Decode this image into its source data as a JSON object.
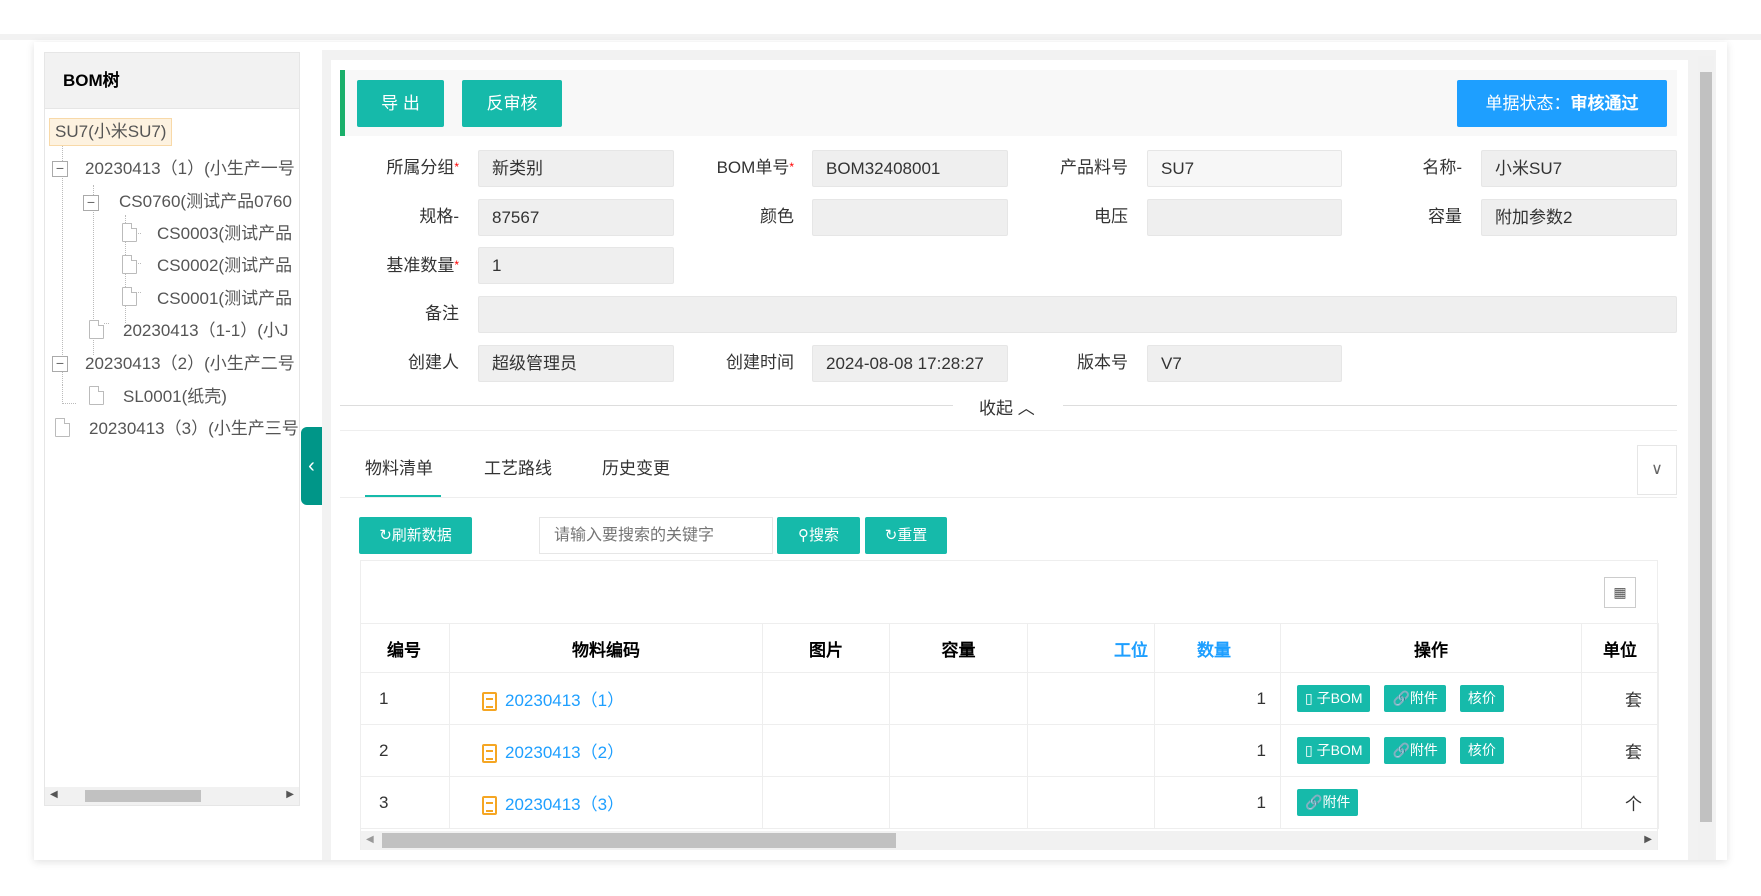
{
  "tree": {
    "title": "BOM树",
    "nodes": [
      {
        "label": "SU7(小米SU7)"
      },
      {
        "label": "20230413（1）(小生产一号"
      },
      {
        "label": "CS0760(测试产品0760"
      },
      {
        "label": "CS0003(测试产品"
      },
      {
        "label": "CS0002(测试产品"
      },
      {
        "label": "CS0001(测试产品"
      },
      {
        "label": "20230413（1-1）(小J"
      },
      {
        "label": "20230413（2）(小生产二号"
      },
      {
        "label": "SL0001(纸壳)"
      },
      {
        "label": "20230413（3）(小生产三号"
      }
    ]
  },
  "toolbar": {
    "export": "导 出",
    "unaudit": "反审核",
    "status_label": "单据状态：",
    "status_value": "审核通过"
  },
  "form": {
    "group": {
      "label": "所属分组",
      "value": "新类别"
    },
    "bom_no": {
      "label": "BOM单号",
      "value": "BOM32408001"
    },
    "product_no": {
      "label": "产品料号",
      "value": "SU7"
    },
    "name": {
      "label": "名称-",
      "value": "小米SU7"
    },
    "spec": {
      "label": "规格-",
      "value": "87567"
    },
    "color": {
      "label": "颜色",
      "value": ""
    },
    "voltage": {
      "label": "电压",
      "value": ""
    },
    "capacity": {
      "label": "容量",
      "value": "附加参数2"
    },
    "base_qty": {
      "label": "基准数量",
      "value": "1"
    },
    "remark": {
      "label": "备注",
      "value": ""
    },
    "creator": {
      "label": "创建人",
      "value": "超级管理员"
    },
    "created": {
      "label": "创建时间",
      "value": "2024-08-08 17:28:27"
    },
    "version": {
      "label": "版本号",
      "value": "V7"
    },
    "required_mark": "*",
    "collapse": "收起 ︿"
  },
  "tabs": [
    "物料清单",
    "工艺路线",
    "历史变更"
  ],
  "actions": {
    "refresh": "刷新数据",
    "search_placeholder": "请输入要搜索的关键字",
    "search": "搜索",
    "reset": "重置"
  },
  "table": {
    "headers": [
      "编号",
      "物料编码",
      "图片",
      "容量",
      "工位",
      "数量",
      "操作",
      "单位"
    ],
    "rows": [
      {
        "no": "1",
        "code": "20230413（1）",
        "qty": "1",
        "ops": [
          "子BOM",
          "附件",
          "核价"
        ],
        "unit": "套"
      },
      {
        "no": "2",
        "code": "20230413（2）",
        "qty": "1",
        "ops": [
          "子BOM",
          "附件",
          "核价"
        ],
        "unit": "套"
      },
      {
        "no": "3",
        "code": "20230413（3）",
        "qty": "1",
        "ops": [
          "附件"
        ],
        "unit": "个"
      }
    ]
  },
  "colors": {
    "teal": "#16baaa",
    "blue": "#1e9fff",
    "green_bar": "#1aaf6a"
  }
}
